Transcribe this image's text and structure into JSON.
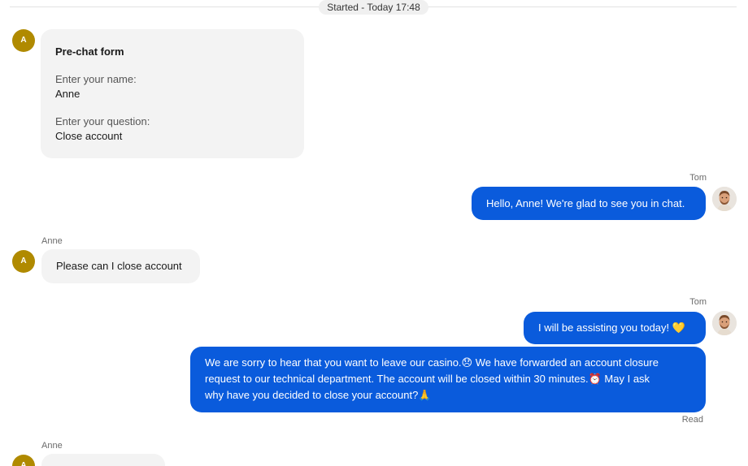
{
  "divider": {
    "label": "Started - Today 17:48"
  },
  "visitor": {
    "initial": "A",
    "name": "Anne"
  },
  "agent": {
    "name": "Tom"
  },
  "prechat": {
    "title": "Pre-chat form",
    "fields": [
      {
        "label": "Enter your name:",
        "value": "Anne"
      },
      {
        "label": "Enter your question:",
        "value": "Close account"
      }
    ]
  },
  "messages": {
    "m1": "Hello, Anne! We're glad to see you in chat.",
    "m2": "Please can I close account",
    "m3": "I will be assisting you today! 💛",
    "m4": {
      "line1": "We are sorry to hear that you want to leave our casino.😞 We have forwarded an account closure",
      "line2": "request to our technical department. The account will be closed within 30 minutes.⏰ May I ask",
      "line3": "why have you decided to close your account?🙏"
    }
  },
  "status": {
    "read": "Read"
  },
  "colors": {
    "accent": "#0a5bdc",
    "visitor_avatar": "#b08a00",
    "bubble_in": "#f3f3f3"
  }
}
